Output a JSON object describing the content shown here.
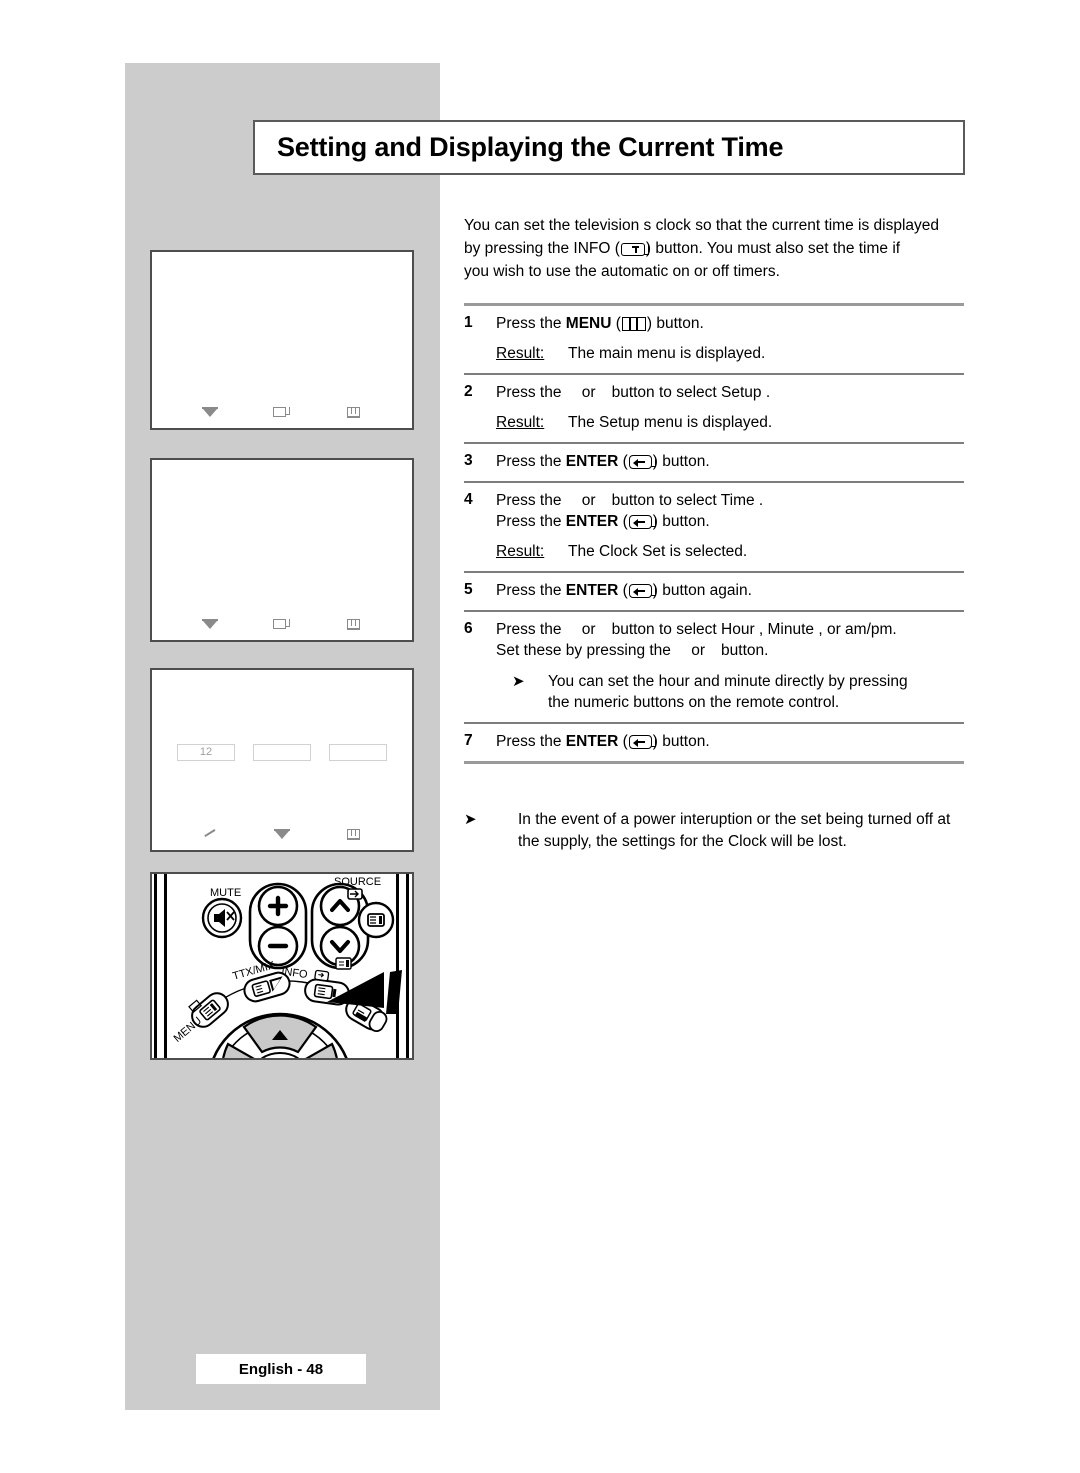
{
  "page": {
    "title": "Setting and Displaying the Current Time",
    "footer_label": "English - 48"
  },
  "intro": {
    "text": "You can set the television s clock so that the current time is displayed by pressing the INFO (  ) button. You must also set the time if you wish to use the automatic on or off timers.",
    "line1": "You can set the television s clock so that the current time is displayed",
    "line2_before_icon": "by pressing the INFO (",
    "line2_after_icon": ") button. You must also set the time if",
    "line3": "you wish to use the automatic on or off timers."
  },
  "steps": [
    {
      "num": "1",
      "line_before_icon": "Press the ",
      "bold_word": "MENU",
      "icon": "menu-icon",
      "line_after_icon": ") button.",
      "paren_open": " (",
      "result_label": "Result:",
      "result_text": "The main menu is displayed."
    },
    {
      "num": "2",
      "text_a": "Press the ",
      "text_or": "or",
      "text_b": "button to select Setup .",
      "result_label": "Result:",
      "result_text": "The Setup  menu is displayed."
    },
    {
      "num": "3",
      "line_before_icon": "Press the ",
      "bold_word": "ENTER",
      "paren_open": " (",
      "icon": "enter-icon",
      "line_after_icon": ") button."
    },
    {
      "num": "4",
      "text_a": "Press the ",
      "text_or": "or",
      "text_b": "button to select Time .",
      "line2_before": "Press the ",
      "line2_bold": "ENTER",
      "line2_paren": " (",
      "line2_after": ") button.",
      "result_label": "Result:",
      "result_text": "The Clock Set   is selected."
    },
    {
      "num": "5",
      "line_before_icon": "Press the ",
      "bold_word": "ENTER",
      "paren_open": " (",
      "icon": "enter-icon",
      "line_after_icon": ") button again."
    },
    {
      "num": "6",
      "text_a": "Press the ",
      "text_or": "or",
      "text_b": "button to select Hour , Minute  , or am/pm.",
      "line2_a": "Set these by pressing the ",
      "line2_or": "or",
      "line2_b": "button.",
      "note_bullet": "➤",
      "note_line1": "You can set the hour and minute directly by pressing",
      "note_line2": "the numeric buttons on the remote control."
    },
    {
      "num": "7",
      "line_before_icon": "Press the ",
      "bold_word": "ENTER",
      "paren_open": " (",
      "icon": "enter-icon",
      "line_after_icon": ") button."
    }
  ],
  "bottom_note": {
    "bullet": "➤",
    "line1": "In the event of a power interuption or the set being turned off at",
    "line2": "the supply, the settings for the Clock will be lost."
  },
  "screens": [
    {
      "name": "menu-screen-1",
      "fields": [],
      "footer_icons": [
        "move-icon",
        "enter-icon",
        "return-icon"
      ]
    },
    {
      "name": "menu-screen-2",
      "fields": [],
      "footer_icons": [
        "move-icon",
        "enter-icon",
        "return-icon"
      ]
    },
    {
      "name": "clock-set-screen",
      "fields": [
        "12",
        "",
        ""
      ],
      "footer_icons": [
        "adjust-icon",
        "move-icon",
        "return-icon"
      ]
    }
  ],
  "remote": {
    "labels": {
      "mute": "MUTE",
      "source": "SOURCE",
      "ttx_mix": "TTX/MIX",
      "info": "INFO",
      "menu": "MENU",
      "plus": "+",
      "minus": "−"
    }
  },
  "colors": {
    "panel_gray": "#cccccc",
    "border_dark": "#4d4d4d",
    "rule_gray": "#9a9a9a",
    "osd_gray": "#8a8a8a",
    "field_border": "#d2d2d2",
    "field_text": "#9f9f9f",
    "text": "#000000"
  }
}
